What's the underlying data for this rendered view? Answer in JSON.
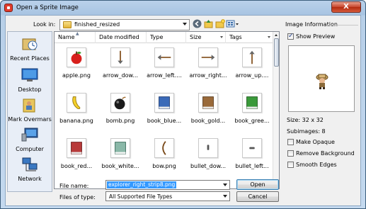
{
  "window": {
    "title": "Open a Sprite Image",
    "close_glyph": "X"
  },
  "lookin": {
    "label": "Look in:",
    "value": "finished_resized"
  },
  "places": [
    {
      "label": "Recent Places",
      "icon": "recent-places-icon"
    },
    {
      "label": "Desktop",
      "icon": "desktop-icon"
    },
    {
      "label": "Mark Overmars",
      "icon": "user-folder-icon"
    },
    {
      "label": "Computer",
      "icon": "computer-icon"
    },
    {
      "label": "Network",
      "icon": "network-icon"
    }
  ],
  "columns": [
    {
      "label": "Name"
    },
    {
      "label": "Date modified"
    },
    {
      "label": "Type"
    },
    {
      "label": "Size"
    },
    {
      "label": "Tags"
    }
  ],
  "files": [
    {
      "name": "apple.png",
      "icon": "apple-icon"
    },
    {
      "name": "arrow_dow...",
      "icon": "arrow-down-icon"
    },
    {
      "name": "arrow_left....",
      "icon": "arrow-left-icon"
    },
    {
      "name": "arrow_right...",
      "icon": "arrow-right-icon"
    },
    {
      "name": "arrow_up....",
      "icon": "arrow-up-icon"
    },
    {
      "name": "banana.png",
      "icon": "banana-icon"
    },
    {
      "name": "bomb.png",
      "icon": "bomb-icon"
    },
    {
      "name": "book_blue...",
      "icon": "book-blue-icon"
    },
    {
      "name": "book_gold...",
      "icon": "book-gold-icon"
    },
    {
      "name": "book_gree...",
      "icon": "book-green-icon"
    },
    {
      "name": "book_red...",
      "icon": "book-red-icon"
    },
    {
      "name": "book_white...",
      "icon": "book-white-icon"
    },
    {
      "name": "bow.png",
      "icon": "bow-icon"
    },
    {
      "name": "bullet_dow...",
      "icon": "bullet-down-icon"
    },
    {
      "name": "bullet_left...",
      "icon": "bullet-left-icon"
    }
  ],
  "filename": {
    "label": "File name:",
    "value": "explorer_right_strip8.png"
  },
  "filetype": {
    "label": "Files of type:",
    "value": "All Supported File Types"
  },
  "buttons": {
    "open": "Open",
    "cancel": "Cancel"
  },
  "info": {
    "title": "Image Information",
    "show_preview": "Show Preview",
    "size": "Size: 32 x 32",
    "subimages": "Subimages: 8",
    "make_opaque": "Make Opaque",
    "remove_background": "Remove Background",
    "smooth_edges": "Smooth Edges"
  },
  "colors": {
    "selection": "#3399ff",
    "title_bar": "#b9d1ea",
    "close_button": "#c7452c"
  }
}
